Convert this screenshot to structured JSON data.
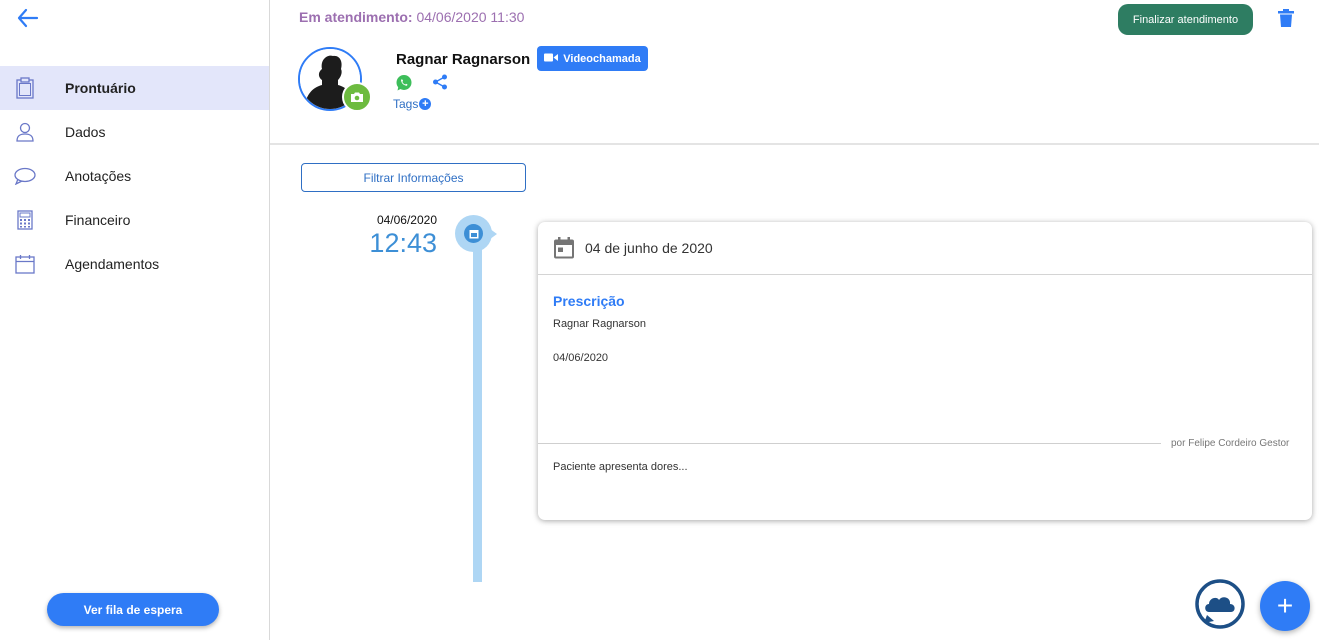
{
  "sidebar": {
    "back_icon": "arrow-left-icon",
    "items": [
      {
        "label": "Prontuário",
        "icon": "clipboard-icon",
        "active": true
      },
      {
        "label": "Dados",
        "icon": "user-icon",
        "active": false
      },
      {
        "label": "Anotações",
        "icon": "chat-bubble-icon",
        "active": false
      },
      {
        "label": "Financeiro",
        "icon": "calculator-icon",
        "active": false
      },
      {
        "label": "Agendamentos",
        "icon": "calendar-icon",
        "active": false
      }
    ],
    "queue_button": "Ver fila de espera"
  },
  "header": {
    "status_label": "Em atendimento:",
    "status_value": " 04/06/2020 11:30",
    "finalize_button": "Finalizar atendimento",
    "patient_name": "Ragnar Ragnarson",
    "video_button": "Videochamada",
    "tags_label": "Tags",
    "tags_add": "+"
  },
  "main": {
    "filter_button": "Filtrar Informações",
    "timeline": [
      {
        "date": "04/06/2020",
        "time": "12:43",
        "card": {
          "title_date": "04 de junho de 2020",
          "doc_type": "Prescrição",
          "patient": "Ragnar Ragnarson",
          "doc_date": "04/06/2020",
          "note": "Paciente apresenta dores...",
          "author": "por Felipe Cordeiro Gestor"
        }
      }
    ],
    "fab_label": "+"
  },
  "colors": {
    "accent": "#2f7cf6",
    "finalize": "#2e7d62",
    "status": "#9c6fb0",
    "timeline": "#aed6f4",
    "camera_badge": "#6dbb3f"
  }
}
